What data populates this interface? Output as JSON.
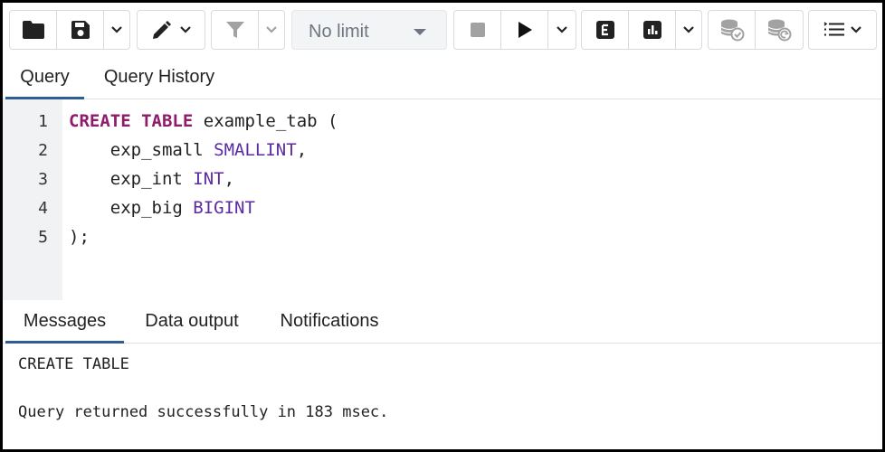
{
  "toolbar": {
    "row_limit": "No limit"
  },
  "query_tabs": {
    "query": "Query",
    "history": "Query History"
  },
  "editor": {
    "line_numbers": [
      "1",
      "2",
      "3",
      "4",
      "5"
    ],
    "lines": [
      {
        "kw1": "CREATE",
        "kw2": "TABLE",
        "name": "example_tab",
        "paren": "("
      },
      {
        "indent": "    ",
        "col": "exp_small",
        "type": "SMALLINT",
        "punct": ","
      },
      {
        "indent": "    ",
        "col": "exp_int",
        "type": "INT",
        "punct": ","
      },
      {
        "indent": "    ",
        "col": "exp_big",
        "type": "BIGINT",
        "punct": ""
      },
      {
        "text": ");"
      }
    ]
  },
  "output_tabs": {
    "messages": "Messages",
    "data_output": "Data output",
    "notifications": "Notifications"
  },
  "messages": {
    "line1": "CREATE TABLE",
    "line2": "Query returned successfully in 183 msec."
  },
  "colors": {
    "keyword": "#8e1c6b",
    "type": "#5b2ba3",
    "active_tab": "#2e5d94"
  }
}
